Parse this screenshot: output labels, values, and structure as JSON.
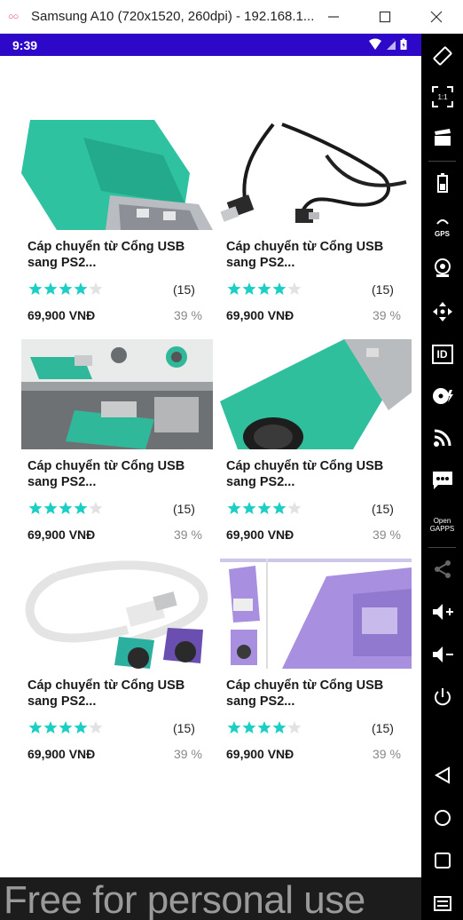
{
  "window": {
    "title": "Samsung A10 (720x1520, 260dpi) - 192.168.1...",
    "minimize_glyph": "—",
    "maximize_glyph": "☐",
    "close_glyph": "✕"
  },
  "status_bar": {
    "time": "9:39"
  },
  "products": [
    {
      "name": "Cáp chuyển từ Cổng USB sang PS2...",
      "rating": 4,
      "reviews": "(15)",
      "price": "69,900 VNĐ",
      "discount": "39 %",
      "image": "usb-ps2-adapter-teal-closeup"
    },
    {
      "name": "Cáp chuyển từ Cổng USB sang PS2...",
      "rating": 4,
      "reviews": "(15)",
      "price": "69,900 VNĐ",
      "discount": "39 %",
      "image": "usb-cable-black"
    },
    {
      "name": "Cáp chuyển từ Cổng USB sang PS2...",
      "rating": 4,
      "reviews": "(15)",
      "price": "69,900 VNĐ",
      "discount": "39 %",
      "image": "usb-ps2-adapters-in-use"
    },
    {
      "name": "Cáp chuyển từ Cổng USB sang PS2...",
      "rating": 4,
      "reviews": "(15)",
      "price": "69,900 VNĐ",
      "discount": "39 %",
      "image": "usb-ps2-adapter-teal"
    },
    {
      "name": "Cáp chuyển từ Cổng USB sang PS2...",
      "rating": 4,
      "reviews": "(15)",
      "price": "69,900 VNĐ",
      "discount": "39 %",
      "image": "usb-ps2-splitter-cable"
    },
    {
      "name": "Cáp chuyển từ Cổng USB sang PS2...",
      "rating": 4,
      "reviews": "(15)",
      "price": "69,900 VNĐ",
      "discount": "39 %",
      "image": "usb-ps2-adapter-purple"
    }
  ],
  "colors": {
    "star_filled": "#1ccfc4",
    "star_empty": "#e2e2e2",
    "status_bar": "#2d08c8",
    "discount": "#888888"
  },
  "sidebar": {
    "buttons": [
      "rotate-icon",
      "pixel-perfect-icon",
      "capture-icon",
      "battery-icon",
      "gps-icon",
      "camera-icon",
      "dpad-icon",
      "identifiers-icon",
      "disk-icon",
      "cast-icon",
      "sms-icon",
      "opengapps-icon",
      "share-icon",
      "volume-up-icon",
      "volume-down-icon",
      "power-icon",
      "back-icon",
      "home-icon",
      "recents-icon",
      "menu-icon"
    ],
    "gps_label": "GPS",
    "id_label": "ID",
    "opengapps_label": "Open\nGAPPS"
  },
  "watermark": "Free for personal use"
}
